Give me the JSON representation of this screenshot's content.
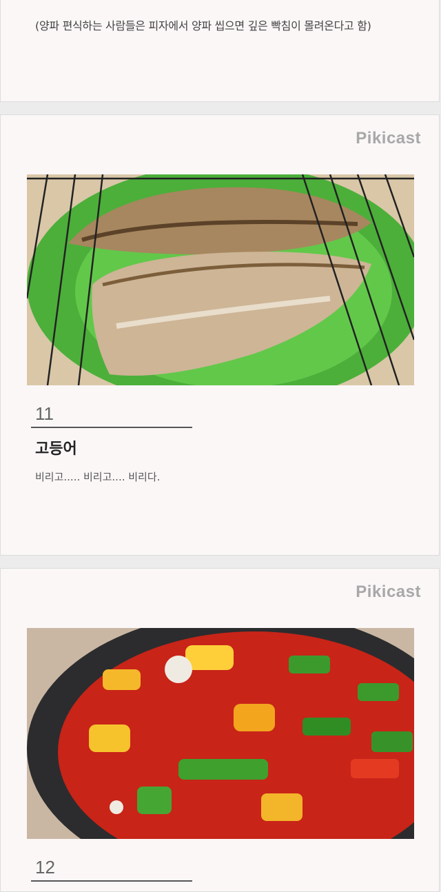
{
  "cards": [
    {
      "caption": "(양파 편식하는 사람들은 피자에서 양파 씹으면 깊은 빡침이 몰려온다고 함)"
    },
    {
      "brand": "Pikicast",
      "image_alt": "grilled mackerel",
      "number": "11",
      "title": "고등어",
      "description": "비리고..... 비리고.... 비리다."
    },
    {
      "brand": "Pikicast",
      "image_alt": "chopped bell peppers in pan",
      "number": "12"
    }
  ]
}
